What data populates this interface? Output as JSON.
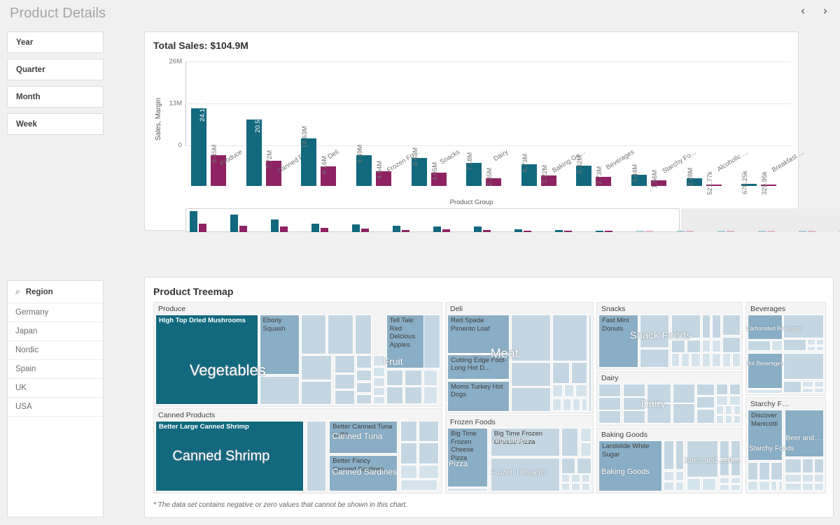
{
  "header": {
    "title": "Product Details",
    "prev_icon": "‹",
    "next_icon": "›"
  },
  "filters": {
    "items": [
      {
        "label": "Year"
      },
      {
        "label": "Quarter"
      },
      {
        "label": "Month"
      },
      {
        "label": "Week"
      }
    ]
  },
  "region_panel": {
    "search_icon": "⌕",
    "title": "Region",
    "values": [
      "Germany",
      "Japan",
      "Nordic",
      "Spain",
      "UK",
      "USA"
    ]
  },
  "bar_chart": {
    "title": "Total Sales: $104.9M",
    "footnote": ""
  },
  "treemap": {
    "title": "Product Treemap",
    "footnote": "* The data set contains negative or zero values that cannot be shown in this chart.",
    "groups": [
      {
        "name": "Produce",
        "categories": [
          "Vegetables",
          "Fruit"
        ],
        "items": [
          "High Top Dried Mushrooms",
          "Ebony Squash",
          "Tell Tale Red Delcious Apples"
        ]
      },
      {
        "name": "Canned Products",
        "categories": [
          "Canned Tuna",
          "Canned Sardines"
        ],
        "items": [
          "Better Large Canned Shrimp",
          "Better Canned Tuna in Oil",
          "Better Fancy Canned Sardines"
        ],
        "big_label": "Canned Shrimp"
      },
      {
        "name": "Deli",
        "categories": [
          "Meat"
        ],
        "items": [
          "Red Spade Pimento Loaf",
          "Cutting Edge Foot-Long Hot D…",
          "Moms Turkey Hot Dogs"
        ]
      },
      {
        "name": "Frozen Foods",
        "categories": [
          "Vegetables",
          "Frozen Desserts",
          "Pizza"
        ],
        "items": [
          "Big Time Frozen Cheese Pizza"
        ]
      },
      {
        "name": "Snacks",
        "categories": [
          "Snack Foods"
        ],
        "items": [
          "Fast Mini Donuts"
        ]
      },
      {
        "name": "Dairy",
        "categories": [
          "Dairy"
        ],
        "items": []
      },
      {
        "name": "Baking Goods",
        "categories": [
          "Baking Goods",
          "Jams and Jellies"
        ],
        "items": [
          "Landslide White Sugar"
        ]
      },
      {
        "name": "Beverages",
        "categories": [
          "Carbonated Beverages",
          "Hot Beverages"
        ],
        "items": []
      },
      {
        "name": "Starchy F…",
        "categories": [
          "Starchy Foods",
          "Beer and…"
        ],
        "items": [
          "Discover Manicotti"
        ]
      }
    ]
  },
  "chart_data": {
    "type": "bar",
    "title": "Total Sales: $104.9M",
    "xlabel": "Product Group",
    "ylabel": "Sales, Margin",
    "ylim": [
      0,
      26000000
    ],
    "yticks": [
      "0",
      "13M",
      "26M"
    ],
    "grid": true,
    "legend": "none",
    "colors": {
      "sales": "#12697e",
      "margin": "#8e2262"
    },
    "categories": [
      "Produce",
      "Canned Pr…",
      "Deli",
      "Frozen Fo…",
      "Snacks",
      "Dairy",
      "Baking Go…",
      "Beverages",
      "Starchy Fo…",
      "Alcoholic …",
      "Breakfast …"
    ],
    "series": [
      {
        "name": "Sales",
        "values": [
          24160000,
          20520000,
          14630000,
          9490000,
          8630000,
          7180000,
          6730000,
          6320000,
          3440000,
          2280000,
          678250
        ],
        "labels": [
          "24.16M",
          "20.52M",
          "14.63M",
          "9.49M",
          "8.63M",
          "7.18M",
          "6.73M",
          "6.32M",
          "3.44M",
          "2.28M",
          "678.25k"
        ]
      },
      {
        "name": "Margin",
        "values": [
          9450000,
          7720000,
          6160000,
          4640000,
          4050000,
          2350000,
          3220000,
          2730000,
          1660000,
          521770,
          329950
        ],
        "labels": [
          "9.45M",
          "7.72M",
          "6.16M",
          "4.64M",
          "4.05M",
          "2.35M",
          "3.22M",
          "2.73M",
          "1.66M",
          "521.77k",
          "329.95k"
        ]
      }
    ]
  }
}
